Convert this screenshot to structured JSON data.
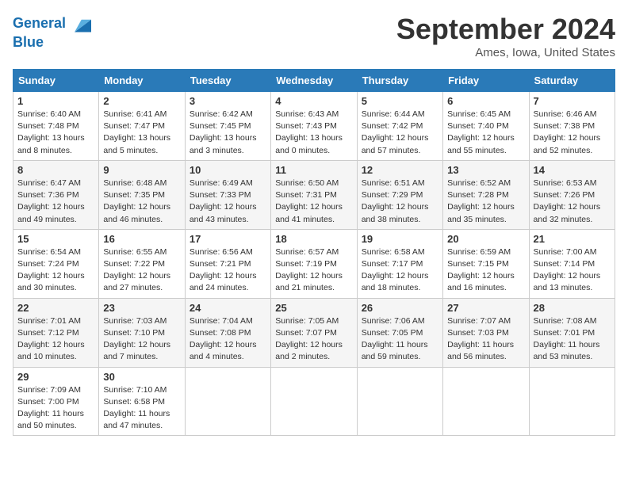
{
  "header": {
    "logo_line1": "General",
    "logo_line2": "Blue",
    "month": "September 2024",
    "location": "Ames, Iowa, United States"
  },
  "weekdays": [
    "Sunday",
    "Monday",
    "Tuesday",
    "Wednesday",
    "Thursday",
    "Friday",
    "Saturday"
  ],
  "weeks": [
    [
      {
        "day": "1",
        "rise": "6:40 AM",
        "set": "7:48 PM",
        "daylight": "13 hours and 8 minutes."
      },
      {
        "day": "2",
        "rise": "6:41 AM",
        "set": "7:47 PM",
        "daylight": "13 hours and 5 minutes."
      },
      {
        "day": "3",
        "rise": "6:42 AM",
        "set": "7:45 PM",
        "daylight": "13 hours and 3 minutes."
      },
      {
        "day": "4",
        "rise": "6:43 AM",
        "set": "7:43 PM",
        "daylight": "13 hours and 0 minutes."
      },
      {
        "day": "5",
        "rise": "6:44 AM",
        "set": "7:42 PM",
        "daylight": "12 hours and 57 minutes."
      },
      {
        "day": "6",
        "rise": "6:45 AM",
        "set": "7:40 PM",
        "daylight": "12 hours and 55 minutes."
      },
      {
        "day": "7",
        "rise": "6:46 AM",
        "set": "7:38 PM",
        "daylight": "12 hours and 52 minutes."
      }
    ],
    [
      {
        "day": "8",
        "rise": "6:47 AM",
        "set": "7:36 PM",
        "daylight": "12 hours and 49 minutes."
      },
      {
        "day": "9",
        "rise": "6:48 AM",
        "set": "7:35 PM",
        "daylight": "12 hours and 46 minutes."
      },
      {
        "day": "10",
        "rise": "6:49 AM",
        "set": "7:33 PM",
        "daylight": "12 hours and 43 minutes."
      },
      {
        "day": "11",
        "rise": "6:50 AM",
        "set": "7:31 PM",
        "daylight": "12 hours and 41 minutes."
      },
      {
        "day": "12",
        "rise": "6:51 AM",
        "set": "7:29 PM",
        "daylight": "12 hours and 38 minutes."
      },
      {
        "day": "13",
        "rise": "6:52 AM",
        "set": "7:28 PM",
        "daylight": "12 hours and 35 minutes."
      },
      {
        "day": "14",
        "rise": "6:53 AM",
        "set": "7:26 PM",
        "daylight": "12 hours and 32 minutes."
      }
    ],
    [
      {
        "day": "15",
        "rise": "6:54 AM",
        "set": "7:24 PM",
        "daylight": "12 hours and 30 minutes."
      },
      {
        "day": "16",
        "rise": "6:55 AM",
        "set": "7:22 PM",
        "daylight": "12 hours and 27 minutes."
      },
      {
        "day": "17",
        "rise": "6:56 AM",
        "set": "7:21 PM",
        "daylight": "12 hours and 24 minutes."
      },
      {
        "day": "18",
        "rise": "6:57 AM",
        "set": "7:19 PM",
        "daylight": "12 hours and 21 minutes."
      },
      {
        "day": "19",
        "rise": "6:58 AM",
        "set": "7:17 PM",
        "daylight": "12 hours and 18 minutes."
      },
      {
        "day": "20",
        "rise": "6:59 AM",
        "set": "7:15 PM",
        "daylight": "12 hours and 16 minutes."
      },
      {
        "day": "21",
        "rise": "7:00 AM",
        "set": "7:14 PM",
        "daylight": "12 hours and 13 minutes."
      }
    ],
    [
      {
        "day": "22",
        "rise": "7:01 AM",
        "set": "7:12 PM",
        "daylight": "12 hours and 10 minutes."
      },
      {
        "day": "23",
        "rise": "7:03 AM",
        "set": "7:10 PM",
        "daylight": "12 hours and 7 minutes."
      },
      {
        "day": "24",
        "rise": "7:04 AM",
        "set": "7:08 PM",
        "daylight": "12 hours and 4 minutes."
      },
      {
        "day": "25",
        "rise": "7:05 AM",
        "set": "7:07 PM",
        "daylight": "12 hours and 2 minutes."
      },
      {
        "day": "26",
        "rise": "7:06 AM",
        "set": "7:05 PM",
        "daylight": "11 hours and 59 minutes."
      },
      {
        "day": "27",
        "rise": "7:07 AM",
        "set": "7:03 PM",
        "daylight": "11 hours and 56 minutes."
      },
      {
        "day": "28",
        "rise": "7:08 AM",
        "set": "7:01 PM",
        "daylight": "11 hours and 53 minutes."
      }
    ],
    [
      {
        "day": "29",
        "rise": "7:09 AM",
        "set": "7:00 PM",
        "daylight": "11 hours and 50 minutes."
      },
      {
        "day": "30",
        "rise": "7:10 AM",
        "set": "6:58 PM",
        "daylight": "11 hours and 47 minutes."
      },
      null,
      null,
      null,
      null,
      null
    ]
  ]
}
